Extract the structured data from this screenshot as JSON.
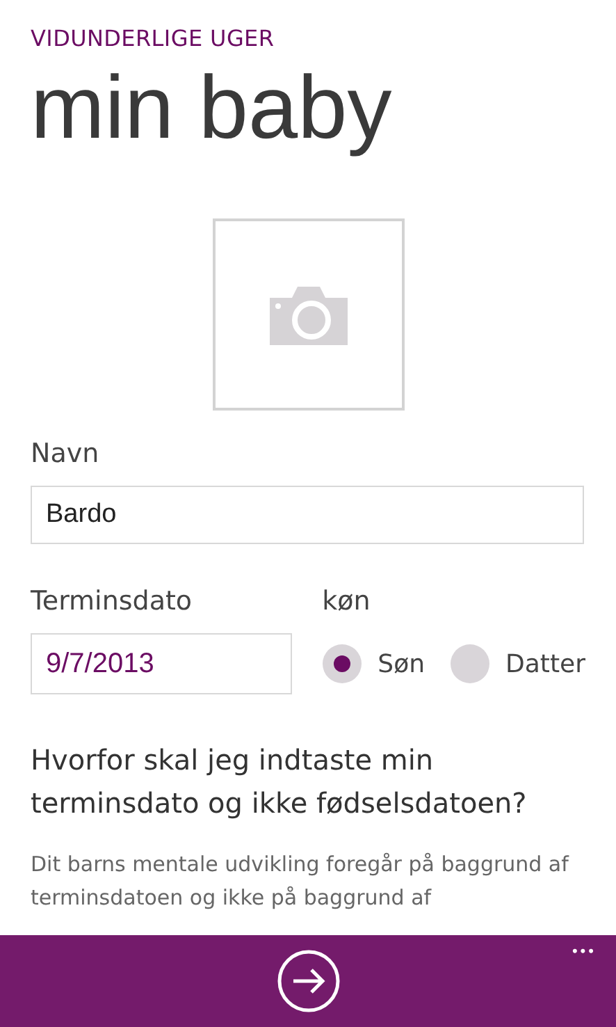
{
  "app_title": "VIDUNDERLIGE UGER",
  "page_title": "min baby",
  "photo": {
    "kind": "placeholder"
  },
  "name_field": {
    "label": "Navn",
    "value": "Bardo"
  },
  "due_date_field": {
    "label": "Terminsdato",
    "value": "9/7/2013"
  },
  "gender": {
    "label": "køn",
    "options": [
      {
        "label": "Søn",
        "selected": true
      },
      {
        "label": "Datter",
        "selected": false
      }
    ]
  },
  "question": "Hvorfor skal jeg indtaste min terminsdato og ikke fødselsdatoen?",
  "explanation": "Dit barns mentale udvikling foregår på baggrund af terminsdatoen og ikke på baggrund af",
  "app_bar": {
    "more": "•••"
  }
}
